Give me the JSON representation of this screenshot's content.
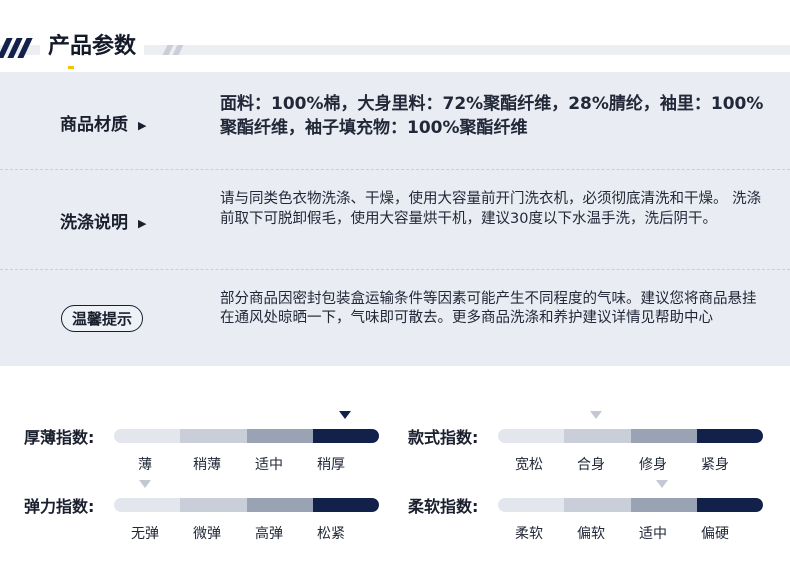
{
  "header": {
    "title": "产品参数"
  },
  "params": [
    {
      "label": "商品材质",
      "text": "面料：100%棉，大身里料：72%聚酯纤维，28%腈纶，袖里：100%聚酯纤维，袖子填充物：100%聚酯纤维"
    },
    {
      "label": "洗涤说明",
      "text": "请与同类色衣物洗涤、干燥，使用大容量前开门洗衣机，必须彻底清洗和干燥。 洗涤前取下可脱卸假毛，使用大容量烘干机，建议30度以下水温手洗，洗后阴干。"
    },
    {
      "label": "温馨提示",
      "text": "部分商品因密封包装盒运输条件等因素可能产生不同程度的气味。建议您将商品悬挂在通风处晾晒一下，气味即可散去。更多商品洗涤和养护建议详情见帮助中心"
    }
  ],
  "indices": [
    {
      "label": "厚薄指数:",
      "options": [
        "薄",
        "稍薄",
        "适中",
        "稍厚"
      ],
      "selected": 3,
      "marker_style": "active"
    },
    {
      "label": "款式指数:",
      "options": [
        "宽松",
        "合身",
        "修身",
        "紧身"
      ],
      "selected": 1,
      "marker_style": "inactive"
    },
    {
      "label": "弹力指数:",
      "options": [
        "无弹",
        "微弹",
        "高弹",
        "松紧"
      ],
      "selected": 0,
      "marker_style": "inactive"
    },
    {
      "label": "柔软指数:",
      "options": [
        "柔软",
        "偏软",
        "适中",
        "偏硬"
      ],
      "selected": 2,
      "marker_style": "inactive"
    }
  ],
  "colors": {
    "dark_navy": "#12214a",
    "panel_bg": "#e9ecf2",
    "accent_yellow": "#f3c200"
  },
  "icons": {
    "row_arrow": "triangle-right-icon",
    "index_marker": "triangle-down-icon"
  }
}
